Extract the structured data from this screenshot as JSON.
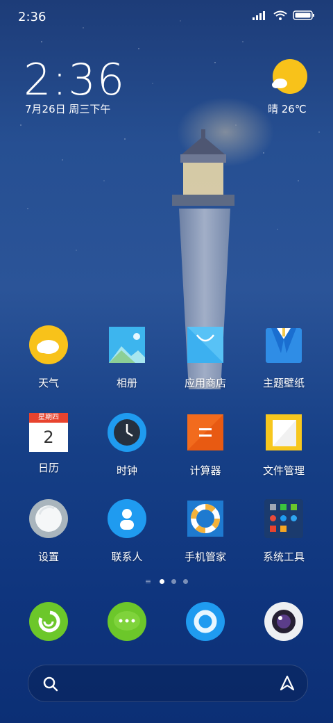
{
  "status_bar": {
    "time": "2:36"
  },
  "lock_widget": {
    "clock": "2:36",
    "date": "7月26日 周三下午",
    "weather": "晴 26℃"
  },
  "apps": [
    {
      "label": "天气",
      "icon": "weather-app-icon"
    },
    {
      "label": "相册",
      "icon": "gallery-icon"
    },
    {
      "label": "应用商店",
      "icon": "app-store-icon"
    },
    {
      "label": "主题壁纸",
      "icon": "themes-icon"
    },
    {
      "label": "日历",
      "icon": "calendar-icon"
    },
    {
      "label": "时钟",
      "icon": "clock-icon"
    },
    {
      "label": "计算器",
      "icon": "calculator-icon"
    },
    {
      "label": "文件管理",
      "icon": "file-manager-icon"
    },
    {
      "label": "设置",
      "icon": "settings-icon"
    },
    {
      "label": "联系人",
      "icon": "contacts-icon"
    },
    {
      "label": "手机管家",
      "icon": "security-icon"
    },
    {
      "label": "系统工具",
      "icon": "system-tools-folder-icon"
    }
  ],
  "calendar_icon": {
    "weekday": "星期四",
    "day": "2"
  },
  "dock": [
    "phone-icon",
    "messages-icon",
    "browser-icon",
    "camera-icon"
  ],
  "page_indicator": {
    "pages": 3,
    "active": 1
  },
  "colors": {
    "accent_yellow": "#f8c21a",
    "accent_blue": "#1f9bf0",
    "accent_orange": "#f26b1d",
    "accent_green": "#6cc72a"
  }
}
